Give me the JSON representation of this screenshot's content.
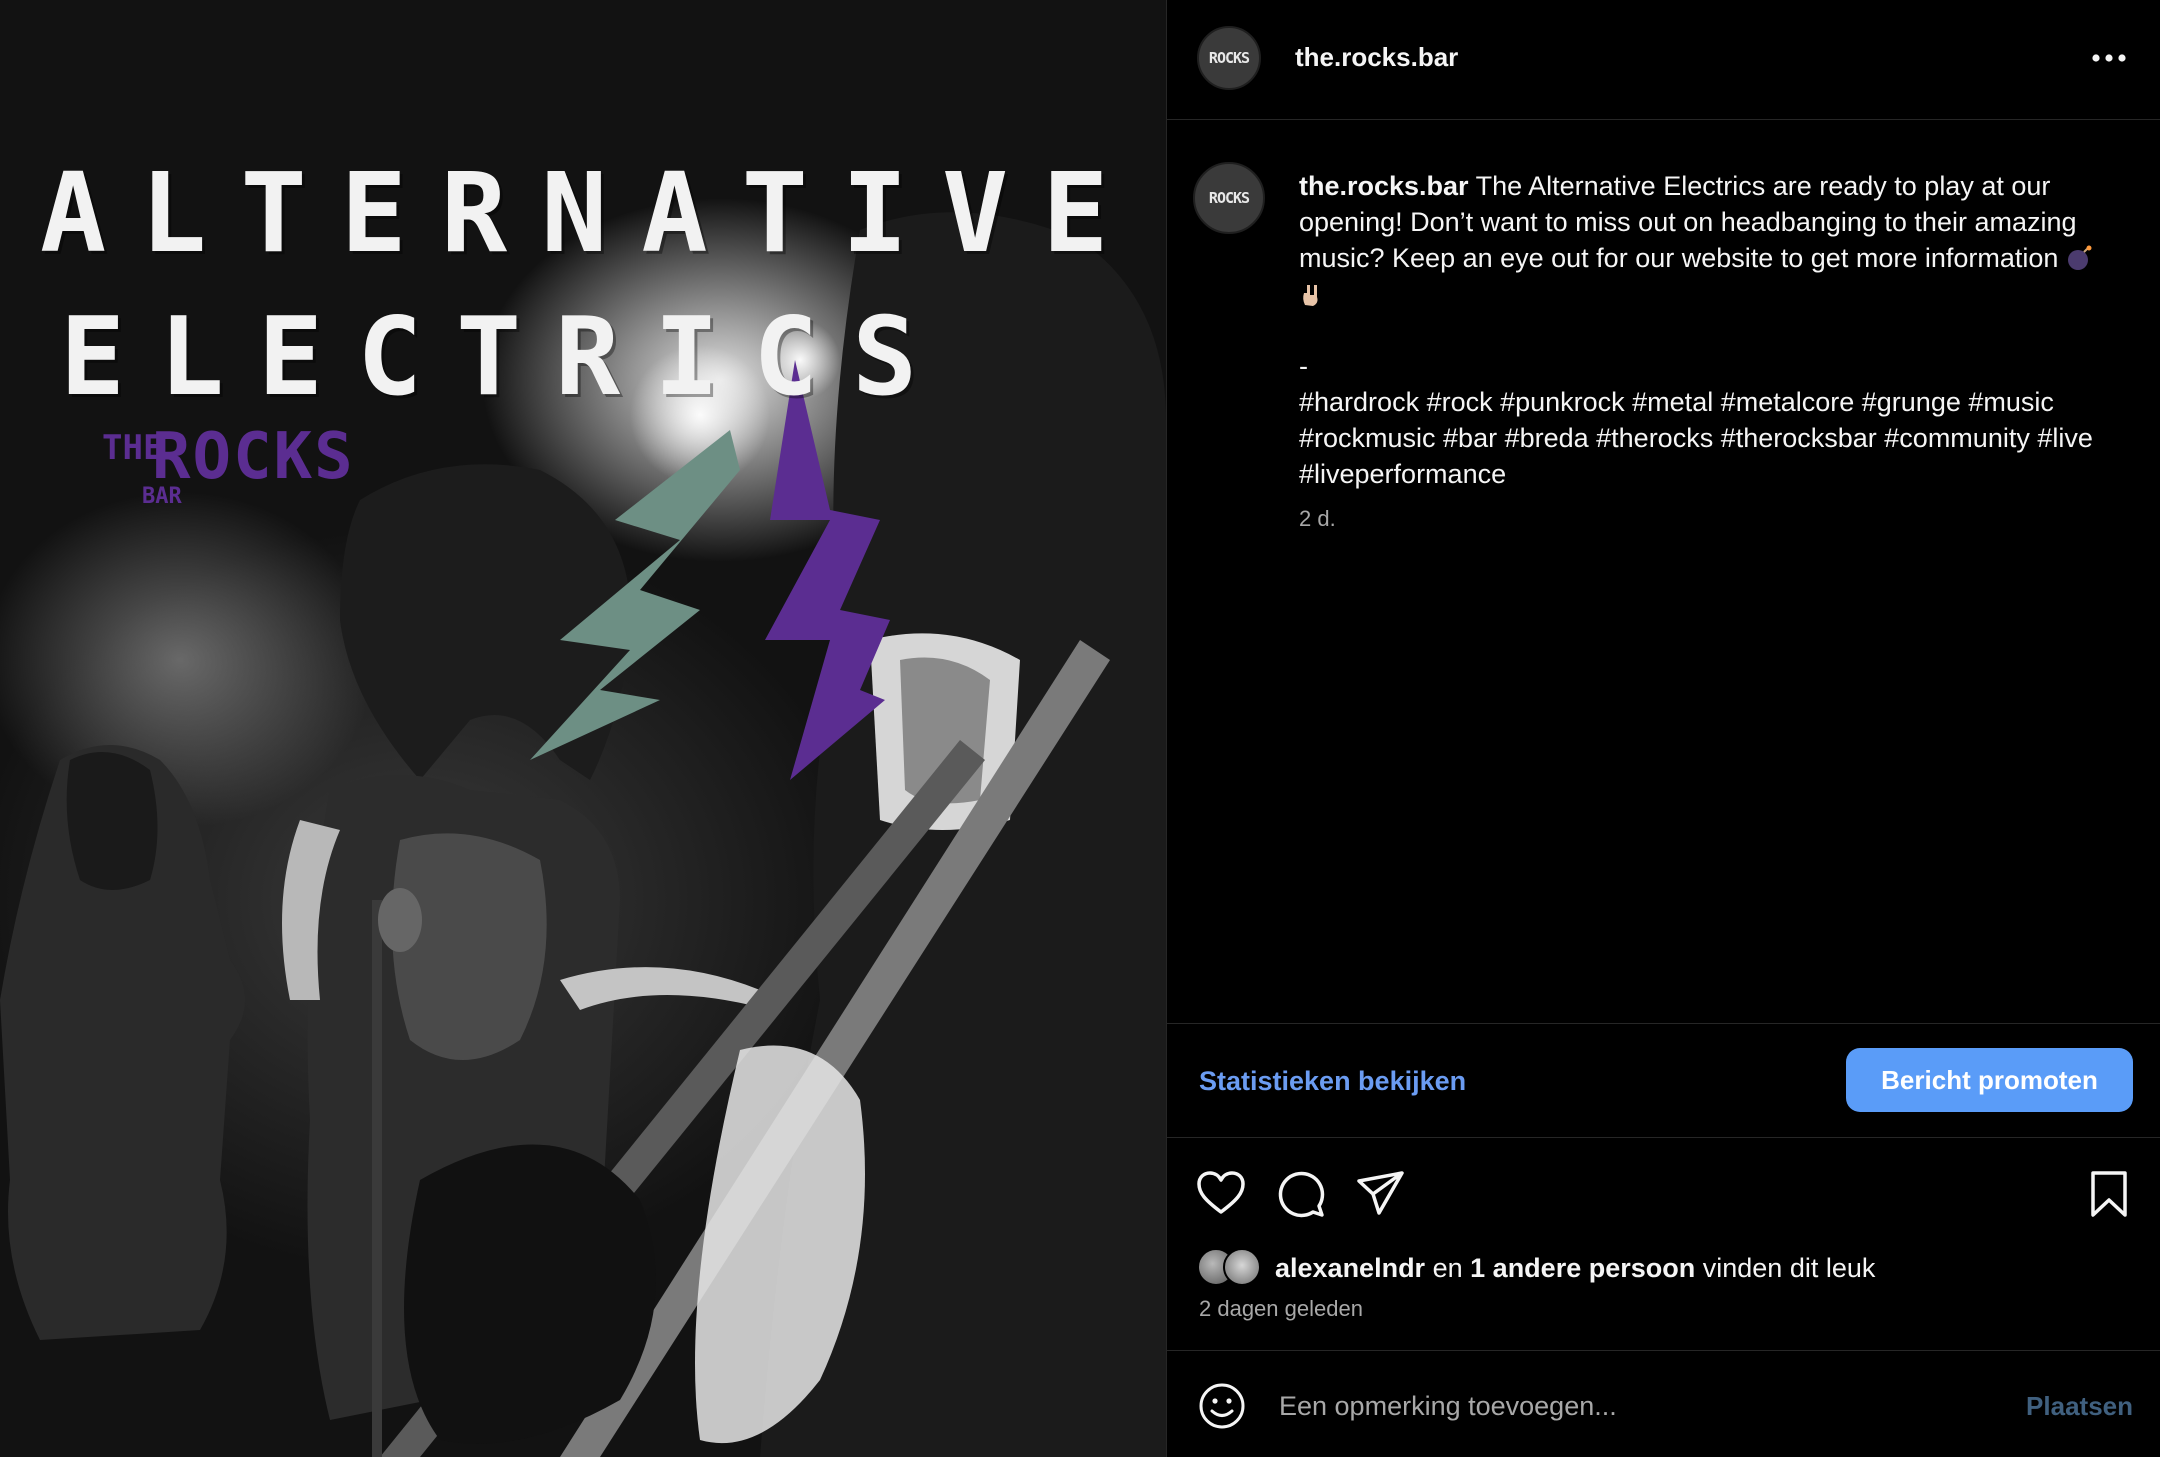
{
  "post_image": {
    "title_line1": "ALTERNATIVE",
    "title_line2": "ELECTRICS",
    "logo_the": "THE",
    "logo_rocks": "ROCKS",
    "logo_bar": "BAR"
  },
  "header": {
    "avatar_text": "ROCKS",
    "username": "the.rocks.bar",
    "more_icon": "more-horizontal-icon"
  },
  "caption": {
    "username": "the.rocks.bar",
    "text": "The Alternative Electrics are ready to play at our opening! Don’t want to miss out on headbanging to their amazing music? Keep an eye out for our website to get more information",
    "emojis": [
      "bomb-emoji",
      "rock-hand-emoji"
    ],
    "dash": "-",
    "hashtags": "#hardrock #rock #punkrock #metal #metalcore #grunge #music #rockmusic #bar #breda #therocks #therocksbar #community #live #liveperformance",
    "time": "2 d."
  },
  "promo": {
    "stats_label": "Statistieken bekijken",
    "promote_label": "Bericht promoten",
    "promote_color": "#5a9cf8",
    "link_color": "#6b9cf2"
  },
  "actions": {
    "icons": [
      "heart-icon",
      "comment-icon",
      "share-icon",
      "bookmark-icon"
    ]
  },
  "likes": {
    "user": "alexanelndr",
    "connector": "en",
    "others": "1 andere persoon",
    "suffix": "vinden dit leuk",
    "ago": "2 dagen geleden"
  },
  "comment": {
    "placeholder": "Een opmerking toevoegen...",
    "post_label": "Plaatsen"
  }
}
